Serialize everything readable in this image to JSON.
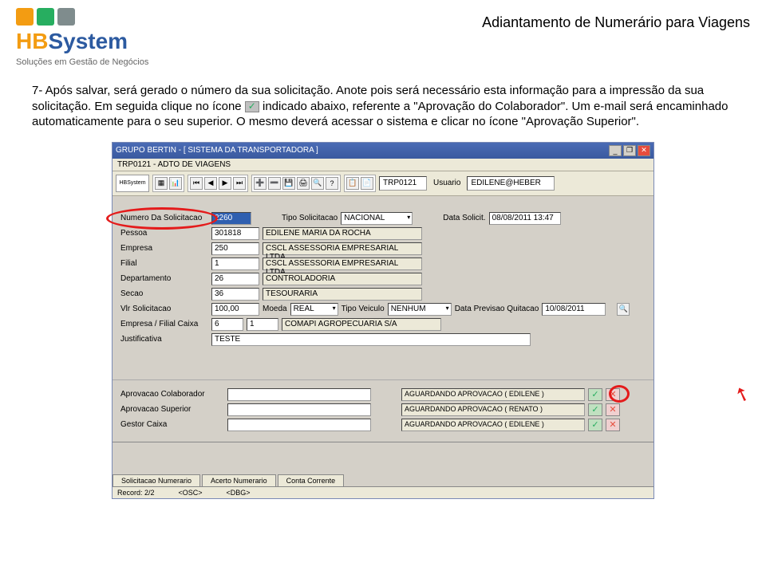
{
  "header": {
    "logo_main1": "HB",
    "logo_main2": "System",
    "logo_tagline": "Soluções em Gestão de Negócios",
    "title": "Adiantamento de Numerário para Viagens"
  },
  "body": {
    "p1a": "7- Após salvar, será gerado o número da sua solicitação. Anote pois será necessário esta informação para a impressão da sua solicitação. Em seguida clique no ícone",
    "p1b": "indicado abaixo, referente a \"Aprovação do Colaborador\". Um e-mail será encaminhado automaticamente para o seu superior. O mesmo deverá acessar o sistema e clicar no ícone \"Aprovação Superior\"."
  },
  "app": {
    "title": "GRUPO BERTIN - [ SISTEMA DA TRANSPORTADORA ]",
    "subtitle": "TRP0121 - ADTO DE VIAGENS",
    "toolbar_logo": "HBSystem",
    "code_label": "TRP0121",
    "user_label": "Usuario",
    "user_value": "EDILENE@HEBER"
  },
  "form": {
    "labels": {
      "num": "Numero Da Solicitacao",
      "tipo": "Tipo Solicitacao",
      "data": "Data Solicit.",
      "pessoa": "Pessoa",
      "empresa": "Empresa",
      "filial": "Filial",
      "depto": "Departamento",
      "secao": "Secao",
      "vlr": "Vlr Solicitacao",
      "moeda": "Moeda",
      "veiculo": "Tipo Veiculo",
      "quitacao": "Data Previsao Quitacao",
      "empfilial": "Empresa / Filial Caixa",
      "justif": "Justificativa"
    },
    "values": {
      "num": "2260",
      "tipo": "NACIONAL",
      "data": "08/08/2011 13:47",
      "pessoa_id": "301818",
      "pessoa_nome": "EDILENE MARIA DA ROCHA",
      "empresa_id": "250",
      "empresa_nome": "CSCL ASSESSORIA EMPRESARIAL LTDA",
      "filial_id": "1",
      "filial_nome": "CSCL ASSESSORIA EMPRESARIAL LTDA",
      "depto_id": "26",
      "depto_nome": "CONTROLADORIA",
      "secao_id": "36",
      "secao_nome": "TESOURARIA",
      "vlr": "100,00",
      "moeda": "REAL",
      "veiculo": "NENHUM",
      "quitacao": "10/08/2011",
      "emp_caixa": "6",
      "filial_caixa": "1",
      "empfilial_nome": "COMAPI AGROPECUARIA S/A",
      "justif": "TESTE"
    }
  },
  "approvals": {
    "rows": [
      {
        "label": "Aprovacao Colaborador",
        "status": "AGUARDANDO APROVACAO ( EDILENE )"
      },
      {
        "label": "Aprovacao Superior",
        "status": "AGUARDANDO APROVACAO ( RENATO )"
      },
      {
        "label": "Gestor Caixa",
        "status": "AGUARDANDO APROVACAO ( EDILENE )"
      }
    ]
  },
  "tabs": [
    "Solicitacao Numerario",
    "Acerto Numerario",
    "Conta Corrente"
  ],
  "statusbar": {
    "record": "Record: 2/2",
    "osc": "<OSC>",
    "dbg": "<DBG>"
  }
}
